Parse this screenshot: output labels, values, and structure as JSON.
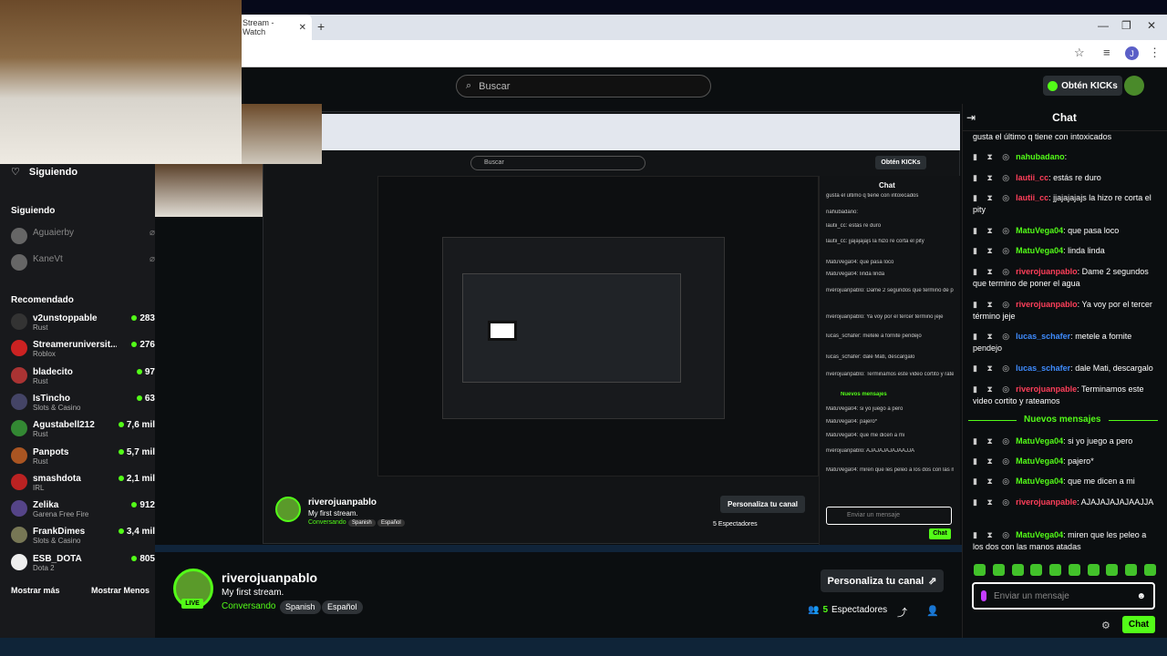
{
  "browser": {
    "tab_title": "Stream - Watch",
    "tab_close": "✕",
    "new_tab": "+",
    "minimize": "—",
    "restore": "❐",
    "close": "✕",
    "profile_initial": "J"
  },
  "header": {
    "search_placeholder": "Buscar",
    "kicks_button": "Obtén KICKs"
  },
  "sidebar": {
    "following_title": "Siguiendo",
    "following_section": "Siguiendo",
    "following": [
      {
        "name": "Aguaierby"
      },
      {
        "name": "KaneVt"
      }
    ],
    "recommended_section": "Recomendado",
    "recommended": [
      {
        "name": "v2unstoppable",
        "category": "Rust",
        "viewers": "283"
      },
      {
        "name": "Streameruniversit...",
        "category": "Roblox",
        "viewers": "276"
      },
      {
        "name": "bladecito",
        "category": "Rust",
        "viewers": "97"
      },
      {
        "name": "IsTincho",
        "category": "Slots & Casino",
        "viewers": "63"
      },
      {
        "name": "Agustabell212",
        "category": "Rust",
        "viewers": "7,6 mil"
      },
      {
        "name": "Panpots",
        "category": "Rust",
        "viewers": "5,7 mil"
      },
      {
        "name": "smashdota",
        "category": "IRL",
        "viewers": "2,1 mil"
      },
      {
        "name": "Zelika",
        "category": "Garena Free Fire",
        "viewers": "912"
      },
      {
        "name": "FrankDimes",
        "category": "Slots & Casino",
        "viewers": "3,4 mil"
      },
      {
        "name": "ESB_DOTA",
        "category": "Dota 2",
        "viewers": "805"
      }
    ],
    "show_more": "Mostrar más",
    "show_less": "Mostrar Menos"
  },
  "stream": {
    "channel": "riverojuanpablo",
    "title": "My first stream.",
    "category": "Conversando",
    "tags": [
      "Spanish",
      "Español"
    ],
    "live_badge": "LIVE",
    "customize_button": "Personaliza tu canal",
    "viewers_count": "5",
    "viewers_label": "Espectadores"
  },
  "nested": {
    "search": "Buscar",
    "kicks": "Obtén KICKs",
    "chat_title": "Chat",
    "lines": [
      "gusta el último q tiene con intoxicados",
      "nahubadano:",
      "lautii_cc: estás re duro",
      "lautii_cc: jjajajajajs la hizo re corta el pity",
      "MatuVega04: que pasa loco",
      "MatuVega04: linda linda",
      "riverojuanpablo: Dame 2 segundos que termino de poner el agua",
      "riverojuanpablo: Ya voy por el tercer término jeje",
      "lucas_schafer: metele a fornite pendejo",
      "lucas_schafer: dale Mati, descargalo",
      "riverojuanpablo: Terminamos este video cortito y rateamos",
      "Nuevos mensajes",
      "MatuVega04: si yo juego a pero",
      "MatuVega04: pajero*",
      "MatuVega04: que me dicen a mi",
      "riverojuanpablo: AJAJAJAJAJAAJJA",
      "MatuVega04: miren que les peleo a los dos con las manos atadas"
    ],
    "channel": "riverojuanpablo",
    "title": "My first stream.",
    "category": "Conversando",
    "tags": [
      "Spanish",
      "Español"
    ],
    "customize": "Personaliza tu canal",
    "viewers": "5 Espectadores",
    "input_placeholder": "Enviar un mensaje",
    "chat_button": "Chat"
  },
  "chat": {
    "title": "Chat",
    "top_line": "gusta el último q tiene con intoxicados",
    "messages_before": [
      {
        "user": "nahubadano",
        "text": "",
        "color": "pink"
      },
      {
        "user": "lautii_cc",
        "text": "estás re duro",
        "color": "red"
      },
      {
        "user": "lautii_cc",
        "text": "jjajajajajs la hizo re corta el pity",
        "color": "red"
      },
      {
        "user": "MatuVega04",
        "text": "que pasa loco",
        "color": "green"
      },
      {
        "user": "MatuVega04",
        "text": "linda linda",
        "color": "green"
      },
      {
        "user": "riverojuanpablo",
        "text": "Dame 2 segundos que termino de poner el agua",
        "color": "red"
      },
      {
        "user": "riverojuanpablo",
        "text": "Ya voy por el tercer término jeje",
        "color": "red"
      },
      {
        "user": "lucas_schafer",
        "text": "metele a fornite pendejo",
        "color": "blue"
      },
      {
        "user": "lucas_schafer",
        "text": "dale Mati, descargalo",
        "color": "blue"
      },
      {
        "user": "riverojuanpable",
        "text": "Terminamos este video cortito y rateamos",
        "color": "red"
      }
    ],
    "new_messages_label": "Nuevos mensajes",
    "messages_after": [
      {
        "user": "MatuVega04",
        "text": "si yo juego a pero",
        "color": "green"
      },
      {
        "user": "MatuVega04",
        "text": "pajero*",
        "color": "green"
      },
      {
        "user": "MatuVega04",
        "text": "que me dicen a mi",
        "color": "green"
      },
      {
        "user": "riverojuanpable",
        "text": "AJAJAJAJAJAAJJA",
        "color": "red"
      },
      {
        "user": "MatuVega04",
        "text": "miren que les peleo a los dos con las manos atadas",
        "color": "green"
      }
    ],
    "input_placeholder": "Enviar un mensaje",
    "send_button": "Chat"
  }
}
